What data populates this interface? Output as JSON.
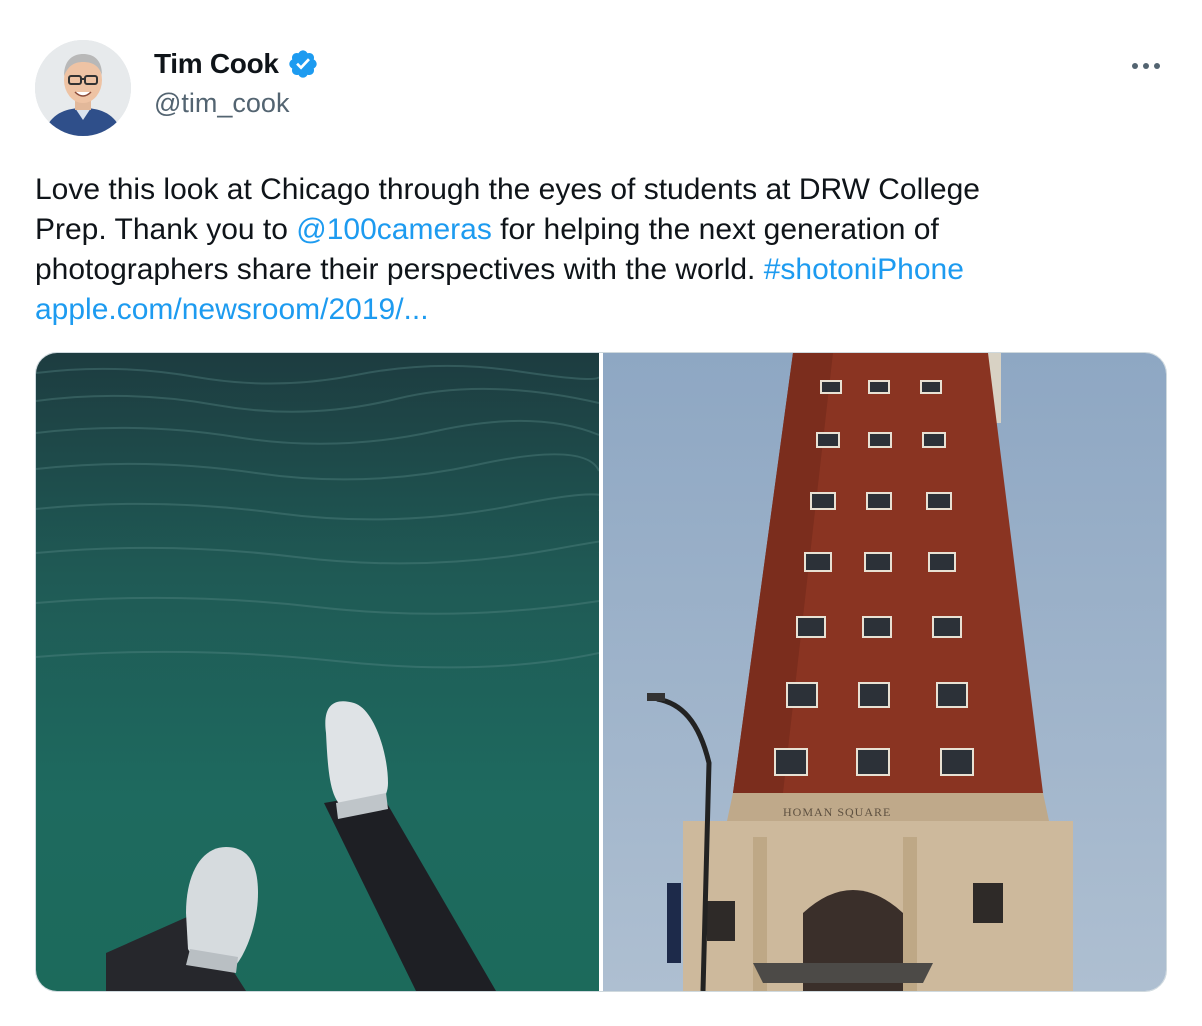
{
  "author": {
    "display_name": "Tim Cook",
    "handle": "@tim_cook",
    "verified": true,
    "avatar_icon": "avatar-photo"
  },
  "menu": {
    "more_label": "..."
  },
  "tweet": {
    "lines": [
      [
        {
          "text": "Love this look at Chicago through the eyes of students at DRW College",
          "link": false
        }
      ],
      [
        {
          "text": "Prep. Thank you to ",
          "link": false
        },
        {
          "text": "@100cameras",
          "link": true
        },
        {
          "text": " for helping the next generation of",
          "link": false
        }
      ],
      [
        {
          "text": "photographers share their perspectives with the world. ",
          "link": false
        },
        {
          "text": "#shotoniPhone",
          "link": true
        }
      ],
      [
        {
          "text": "apple.com/newsroom/2019/...",
          "link": true
        }
      ]
    ]
  },
  "media": {
    "photos": [
      {
        "name": "photo-feet-over-water",
        "content": "sneakers dangling over green lake water"
      },
      {
        "name": "photo-homan-square-tower",
        "content": "red brick tower",
        "sign_text": "HOMAN SQUARE"
      }
    ]
  },
  "colors": {
    "link": "#1d9bf0",
    "text": "#0f1419",
    "secondary": "#536471",
    "verified": "#1d9bf0",
    "border": "#cfd9de"
  }
}
